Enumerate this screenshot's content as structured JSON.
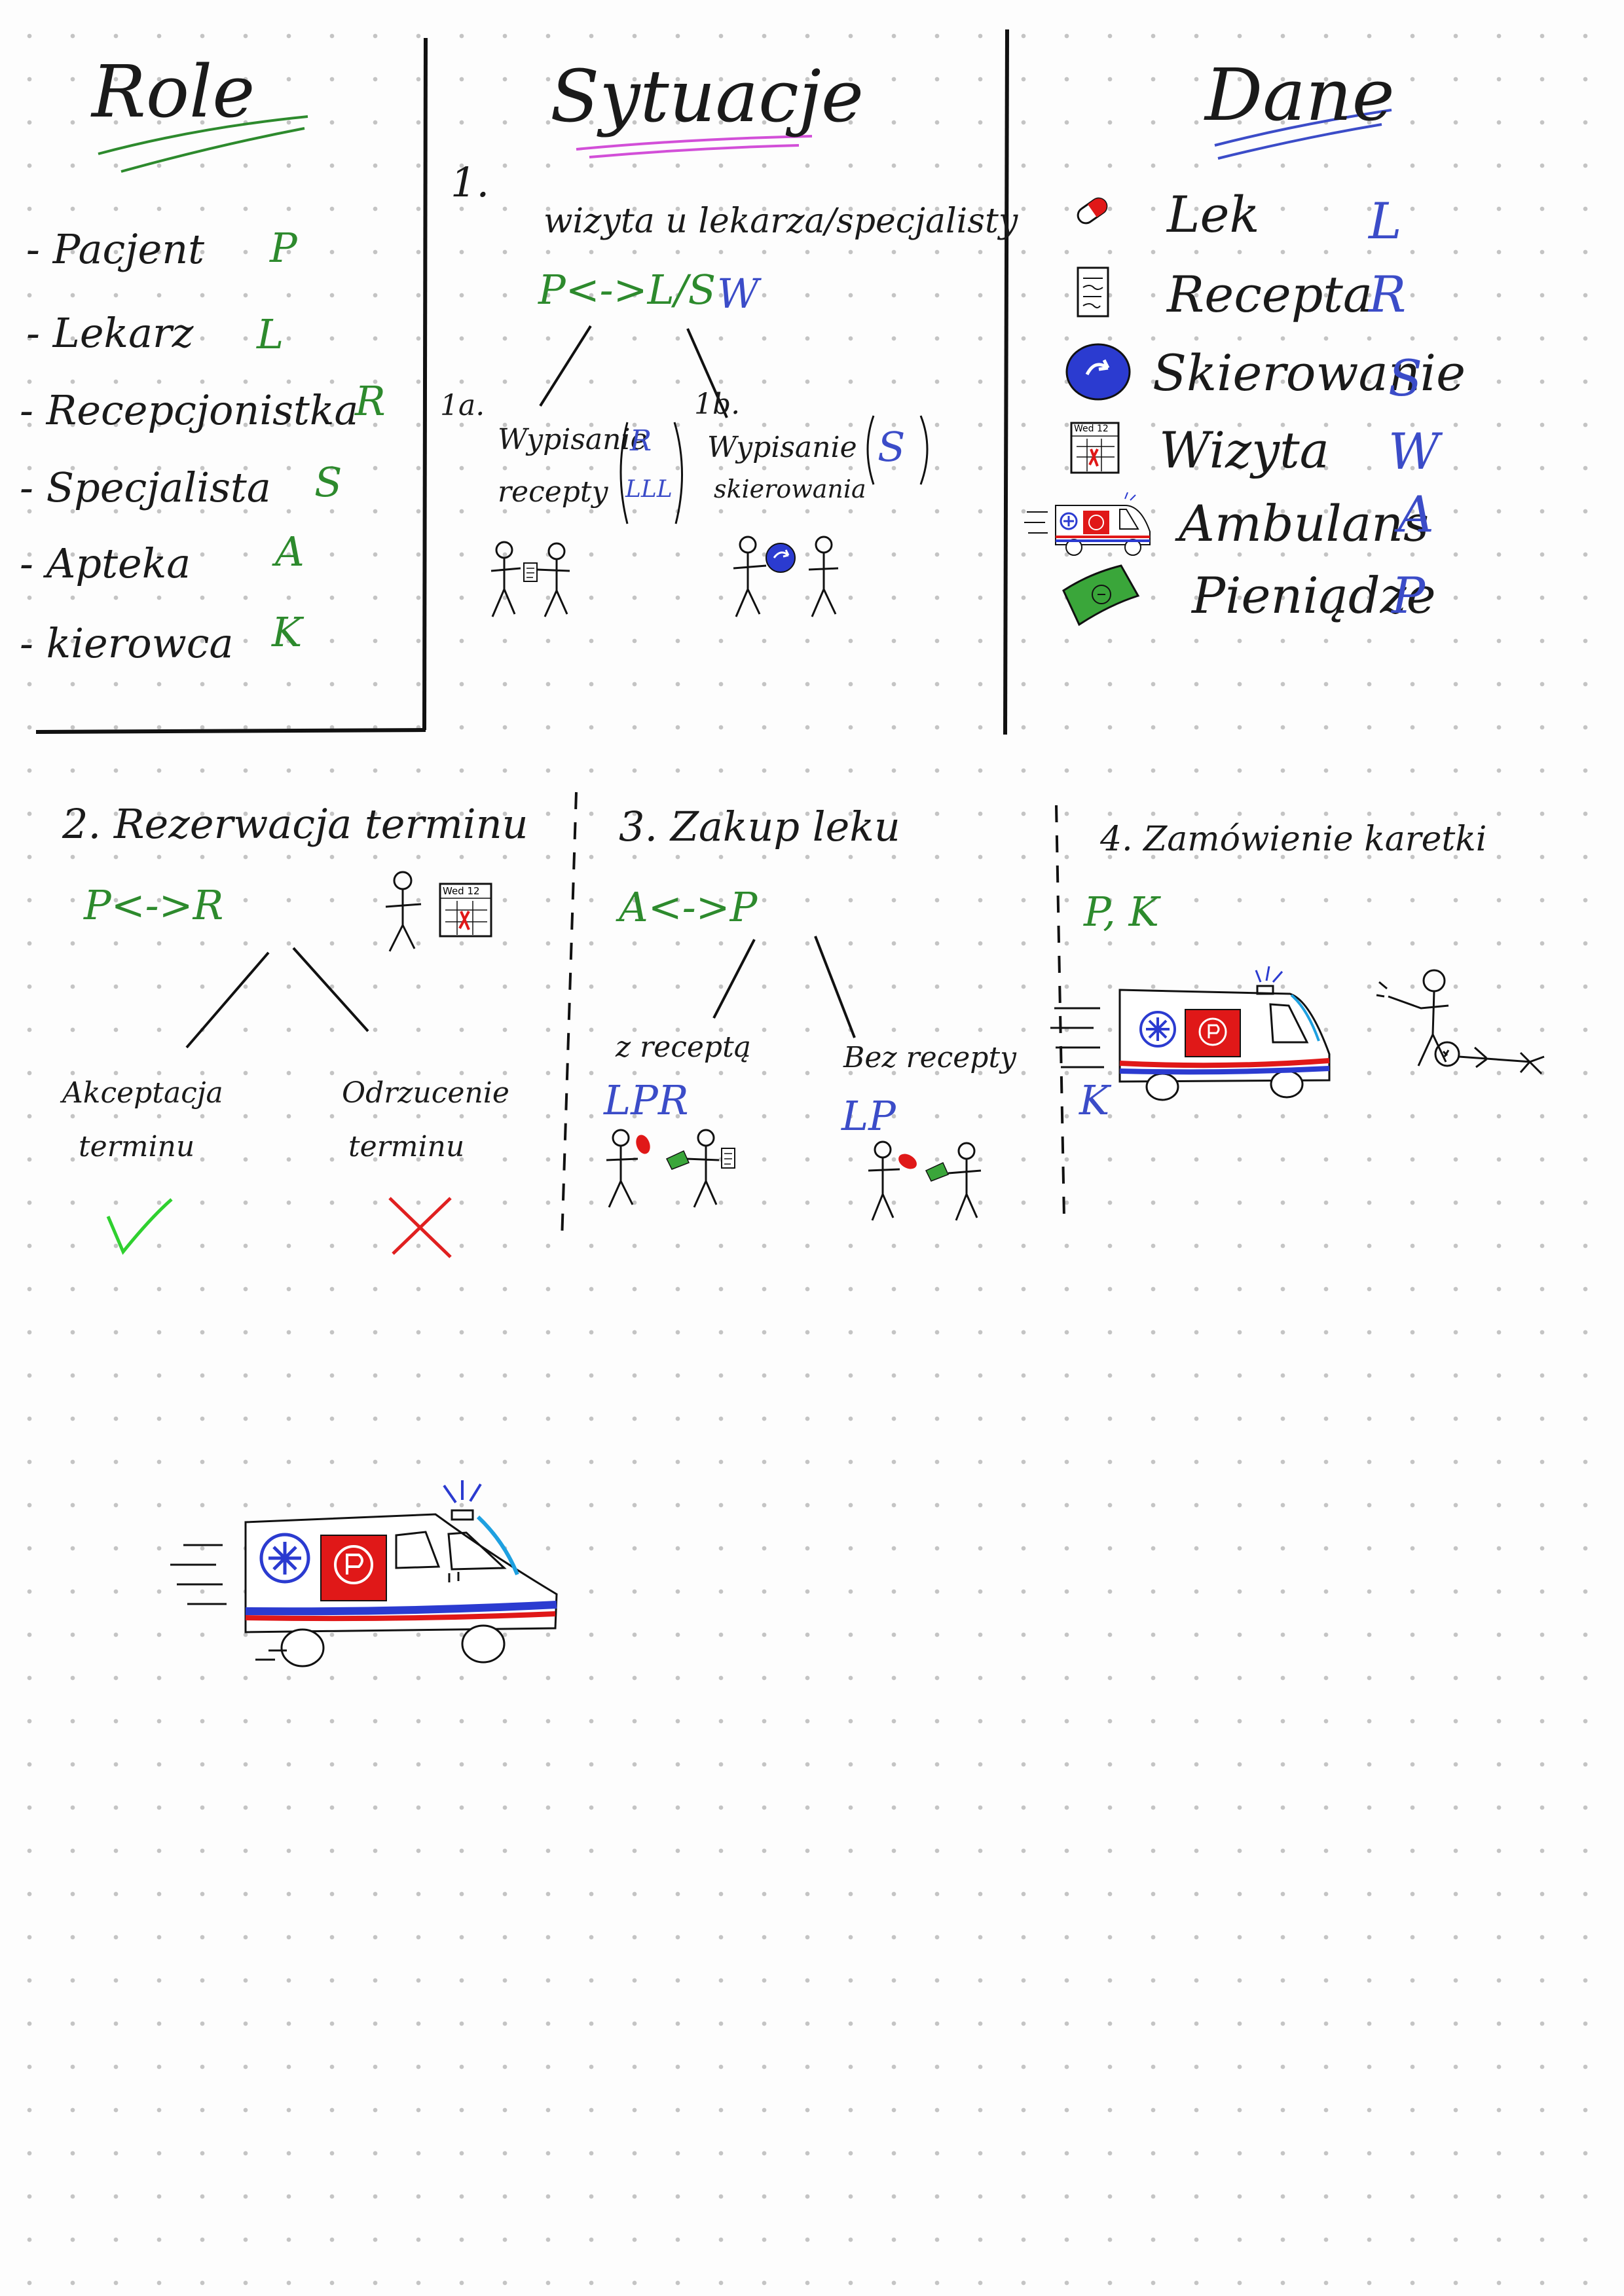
{
  "colors": {
    "ink": "#1a1a1a",
    "role_letter": "#2d8a2d",
    "data_letter": "#3b4cc8",
    "underline_roles": "#2d8a2d",
    "underline_situations": "#d24fd8",
    "underline_data": "#3b4cc8",
    "accept": "#2fd02f",
    "reject": "#e02020",
    "pill_red": "#e01818",
    "money_green": "#3aa63a",
    "ambulance_red": "#e01818",
    "ambulance_blue": "#2b3bd0"
  },
  "roles": {
    "title": "Role",
    "items": [
      {
        "label": "- Pacjent",
        "letter": "P"
      },
      {
        "label": "- Lekarz",
        "letter": "L"
      },
      {
        "label": "- Recepcjonistka",
        "letter": "R"
      },
      {
        "label": "- Specjalista",
        "letter": "S"
      },
      {
        "label": "- Apteka",
        "letter": "A"
      },
      {
        "label": "- kierowca",
        "letter": "K"
      }
    ]
  },
  "situations": {
    "title": "Sytuacje",
    "s1": {
      "number": "1.",
      "title": "wizyta u lekarza/specjalisty",
      "actors": "P<->L/S",
      "data": "W",
      "a_label": "1a.",
      "a_text_1": "Wypisanie",
      "a_text_2": "recepty",
      "a_data_top": "R",
      "a_data_bottom": "LLL",
      "b_label": "1b.",
      "b_text_1": "Wypisanie",
      "b_text_2": "skierowania",
      "b_data": "S"
    },
    "s2": {
      "title": "2. Rezerwacja terminu",
      "actors": "P<->R",
      "calendar": "Wed 12",
      "accept_1": "Akceptacja",
      "accept_2": "terminu",
      "reject_1": "Odrzucenie",
      "reject_2": "terminu"
    },
    "s3": {
      "title": "3. Zakup leku",
      "actors": "A<->P",
      "with_rx": "z receptą",
      "with_rx_data": "LPR",
      "without_rx": "Bez recepty",
      "without_rx_data": "LP"
    },
    "s4": {
      "title": "4. Zamówienie karetki",
      "actors": "P, K",
      "data": "K"
    }
  },
  "data_legend": {
    "title": "Dane",
    "items": [
      {
        "icon": "pill-icon",
        "label": "Lek",
        "letter": "L"
      },
      {
        "icon": "prescription-icon",
        "label": "Recepta",
        "letter": "R"
      },
      {
        "icon": "referral-icon",
        "label": "Skierowanie",
        "letter": "S"
      },
      {
        "icon": "calendar-icon",
        "label": "Wizyta",
        "letter": "W",
        "calendar": "Wed 12"
      },
      {
        "icon": "ambulance-icon",
        "label": "Ambulans",
        "letter": "A"
      },
      {
        "icon": "money-icon",
        "label": "Pieniądze",
        "letter": "P"
      }
    ]
  }
}
